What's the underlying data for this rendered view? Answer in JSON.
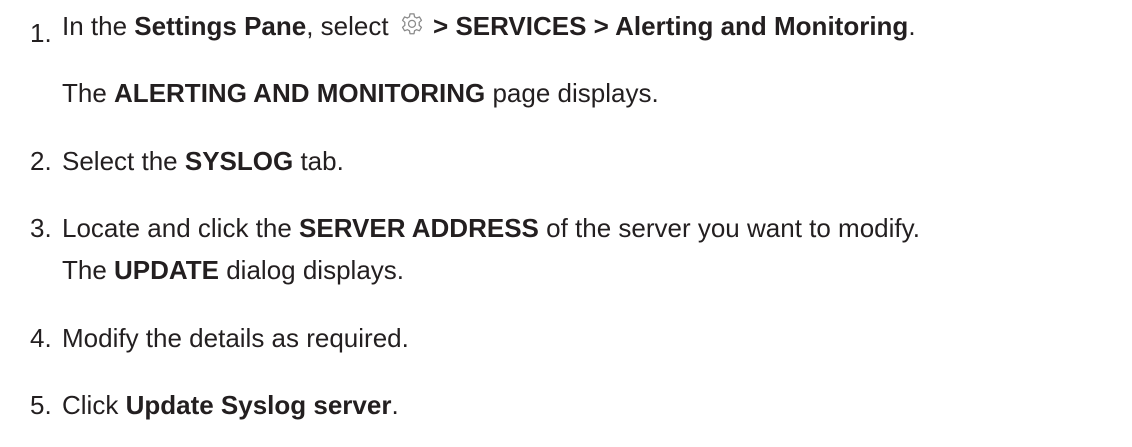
{
  "steps": [
    {
      "number": "1.",
      "intro": "In the ",
      "settings_pane": "Settings Pane",
      "select_text": ", select ",
      "gear_icon": "gear-icon",
      "path": " > SERVICES > Alerting and Monitoring",
      "end": ".",
      "result_prefix": "The ",
      "result_page": "ALERTING AND MONITORING",
      "result_suffix": " page displays."
    },
    {
      "number": "2.",
      "text_before": "Select the ",
      "bold": "SYSLOG",
      "text_after": " tab."
    },
    {
      "number": "3.",
      "text_before": "Locate and click the ",
      "bold": "SERVER ADDRESS",
      "text_after": " of the server you want to modify.",
      "result_prefix": "The ",
      "result_bold": "UPDATE",
      "result_suffix": " dialog displays."
    },
    {
      "number": "4.",
      "text": "Modify the details as required."
    },
    {
      "number": "5.",
      "text_before": "Click ",
      "bold": "Update Syslog server",
      "text_after": "."
    }
  ]
}
